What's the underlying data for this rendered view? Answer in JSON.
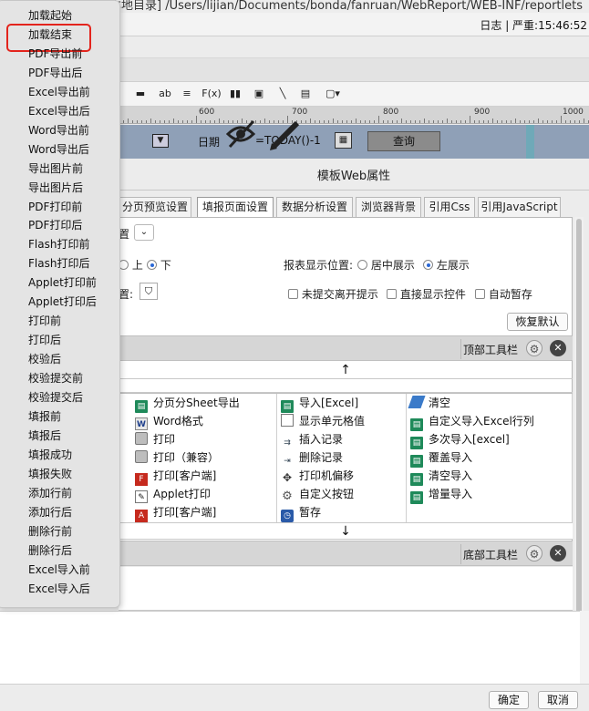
{
  "window": {
    "path_fragment": "本地目录] /Users/lijian/Documents/bonda/fanruan/WebReport/WEB-INF/reportlets",
    "log_status": "日志 | 严重:15:46:52"
  },
  "toolbar": {
    "items": [
      "▬",
      "ab",
      "≡",
      "F(x)",
      "▮▮",
      "▣",
      "╲",
      "▤",
      "▢▾"
    ]
  },
  "ruler": {
    "labels": [
      "600",
      "700",
      "800",
      "900",
      "1000"
    ]
  },
  "param_bar": {
    "date_label": "日期",
    "date_value": "=TODAY()-1",
    "query_button": "查询"
  },
  "dialog": {
    "title": "模板Web属性",
    "tabs": [
      "分页预览设置",
      "填报页面设置",
      "数据分析设置",
      "浏览器背景",
      "引用Css",
      "引用JavaScript"
    ],
    "active_tab": "填报页面设置",
    "settings": {
      "dropdown_fragment": "置",
      "position_up": "上",
      "position_down": "下",
      "report_pos_label": "报表显示位置:",
      "report_pos_center": "居中展示",
      "report_pos_left": "左展示",
      "bg_label_fragment": "置:",
      "unsubmitted_prompt": "未提交离开提示",
      "direct_show_controls": "直接显示控件",
      "auto_save": "自动暂存",
      "restore_default": "恢复默认"
    },
    "top_toolbar_label": "顶部工具栏",
    "bottom_toolbar_label": "底部工具栏",
    "arrow_up": "↑",
    "arrow_down": "↓",
    "buttons_grid": {
      "col1": [
        {
          "label": "分页分Sheet导出",
          "icon": "sheet-export-icon"
        },
        {
          "label": "Word格式",
          "icon": "word-icon"
        },
        {
          "label": "打印",
          "icon": "printer-icon"
        },
        {
          "label": "打印（兼容）",
          "icon": "printer-icon"
        },
        {
          "label": "打印[客户端]",
          "icon": "pdf-icon"
        },
        {
          "label": "Applet打印",
          "icon": "document-icon"
        },
        {
          "label": "打印[客户端]",
          "icon": "pdf-icon"
        }
      ],
      "col2": [
        {
          "label": "导入[Excel]",
          "icon": "sheet-import-icon"
        },
        {
          "label": "显示单元格值",
          "icon": "cell-icon"
        },
        {
          "label": "插入记录",
          "icon": "insert-row-icon"
        },
        {
          "label": "删除记录",
          "icon": "delete-row-icon"
        },
        {
          "label": "打印机偏移",
          "icon": "move-icon"
        },
        {
          "label": "自定义按钮",
          "icon": "gear-icon"
        },
        {
          "label": "暂存",
          "icon": "save-icon"
        }
      ],
      "col3": [
        {
          "label": "清空",
          "icon": "eraser-icon"
        },
        {
          "label": "自定义导入Excel行列",
          "icon": "sheet-import-icon"
        },
        {
          "label": "多次导入[excel]",
          "icon": "sheet-import-icon"
        },
        {
          "label": "覆盖导入",
          "icon": "sheet-import-icon"
        },
        {
          "label": "清空导入",
          "icon": "sheet-import-icon"
        },
        {
          "label": "增量导入",
          "icon": "sheet-import-icon"
        }
      ]
    },
    "footer": {
      "ok": "确定",
      "cancel": "取消"
    }
  },
  "event_menu": {
    "items": [
      "加载起始",
      "加载结束",
      "PDF导出前",
      "PDF导出后",
      "Excel导出前",
      "Excel导出后",
      "Word导出前",
      "Word导出后",
      "导出图片前",
      "导出图片后",
      "PDF打印前",
      "PDF打印后",
      "Flash打印前",
      "Flash打印后",
      "Applet打印前",
      "Applet打印后",
      "打印前",
      "打印后",
      "校验后",
      "校验提交前",
      "校验提交后",
      "填报前",
      "填报后",
      "填报成功",
      "填报失败",
      "添加行前",
      "添加行后",
      "删除行前",
      "删除行后",
      "Excel导入前",
      "Excel导入后"
    ],
    "highlighted": "加载结束",
    "highlight_color": "#e3241c"
  },
  "colors": {
    "param_bar_bg": "#8fa0b7",
    "accent_radio": "#2a68d6",
    "query_button_bg": "#8b8b8b"
  }
}
